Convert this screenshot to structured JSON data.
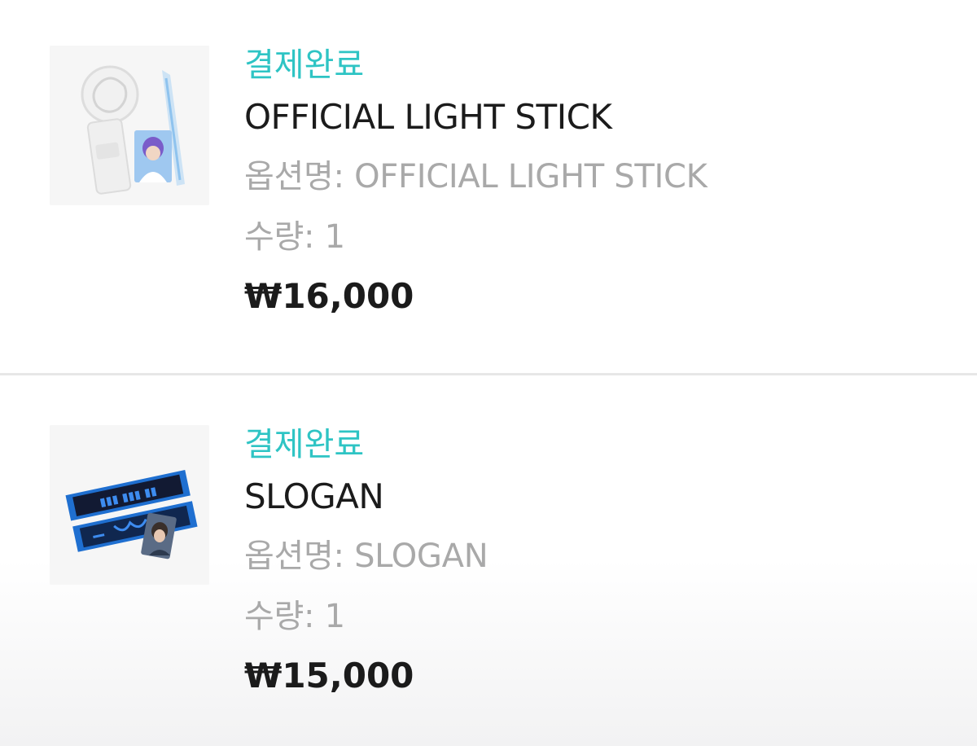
{
  "orders": [
    {
      "status": "결제완료",
      "name": "OFFICIAL LIGHT STICK",
      "option_label": "옵션명: ",
      "option_value": "OFFICIAL LIGHT STICK",
      "qty_label": "수량: ",
      "qty_value": "1",
      "price": "₩16,000",
      "thumbnail_icon": "light-stick-photo"
    },
    {
      "status": "결제완료",
      "name": "SLOGAN",
      "option_label": "옵션명: ",
      "option_value": "SLOGAN",
      "qty_label": "수량: ",
      "qty_value": "1",
      "price": "₩15,000",
      "thumbnail_icon": "slogan-photo"
    }
  ],
  "colors": {
    "status": "#2ec4c4",
    "title": "#1b1b1b",
    "muted": "#a9a9a9",
    "divider": "#e7e7e7"
  }
}
